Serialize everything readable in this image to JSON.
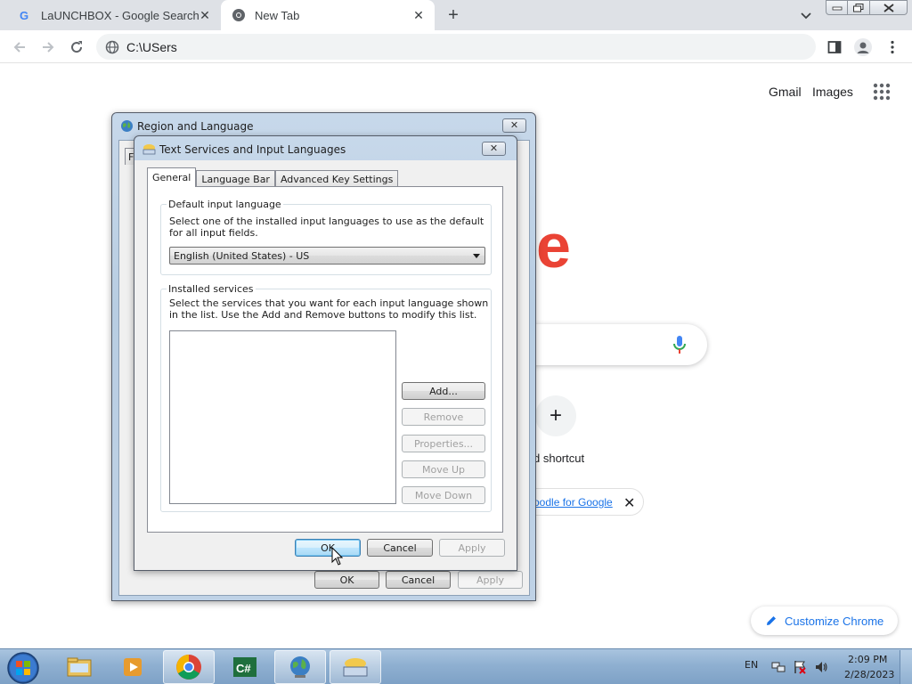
{
  "browser": {
    "tabs": [
      {
        "title": "LaUNCHBOX - Google Search",
        "favicon": "google-g-icon",
        "active": false
      },
      {
        "title": "New Tab",
        "favicon": "chrome-icon",
        "active": true
      }
    ],
    "new_tab_label": "+",
    "address": "C:\\USers",
    "tab_close_glyph": "✕"
  },
  "ntp": {
    "gmail": "Gmail",
    "images": "Images",
    "logo_partial": "e",
    "add_shortcut_glyph": "+",
    "add_shortcut_label": "d shortcut",
    "promo_link": "oodle for Google",
    "promo_close": "✕",
    "customize": "Customize Chrome"
  },
  "region_dialog": {
    "title": "Region and Language",
    "close_glyph": "✕",
    "tab_partial": "F",
    "ok": "OK",
    "cancel": "Cancel",
    "apply": "Apply"
  },
  "tsil_dialog": {
    "title": "Text Services and Input Languages",
    "close_glyph": "✕",
    "tabs": [
      "General",
      "Language Bar",
      "Advanced Key Settings"
    ],
    "default_group": {
      "legend": "Default input language",
      "description": "Select one of the installed input languages to use as the default for all input fields.",
      "selected_language": "English (United States) - US"
    },
    "installed_group": {
      "legend": "Installed services",
      "description": "Select the services that you want for each input language shown in the list. Use the Add and Remove buttons to modify this list.",
      "buttons": {
        "add": "Add...",
        "remove": "Remove",
        "properties": "Properties...",
        "move_up": "Move Up",
        "move_down": "Move Down"
      }
    },
    "ok": "OK",
    "cancel": "Cancel",
    "apply": "Apply"
  },
  "taskbar": {
    "items": [
      "explorer-icon",
      "media-player-icon",
      "chrome-icon",
      "csharp-icon",
      "region-globe-icon",
      "keyboard-icon"
    ],
    "lang": "EN",
    "time": "2:09 PM",
    "date": "2/28/2023"
  }
}
